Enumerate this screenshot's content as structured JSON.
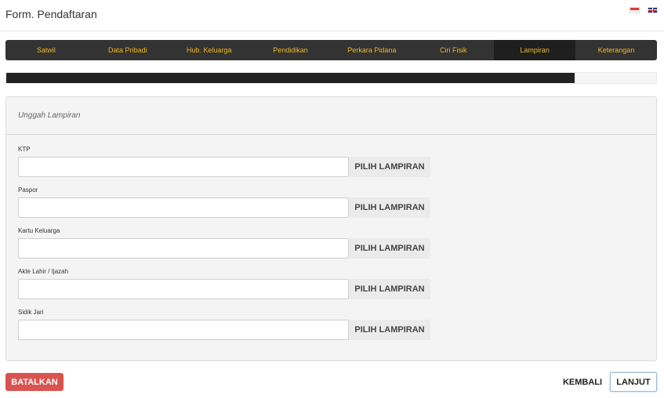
{
  "header": {
    "title": "Form. Pendaftaran",
    "flags": [
      {
        "name": "indonesia-flag-icon",
        "colors": [
          "#e53935",
          "#f5f5f5"
        ]
      },
      {
        "name": "uk-flag-icon",
        "colors": [
          "#1a3d8f",
          "#ffffff",
          "#c62828"
        ]
      }
    ]
  },
  "tabs": [
    {
      "label": "Satwil",
      "active": false
    },
    {
      "label": "Data Pribadi",
      "active": false
    },
    {
      "label": "Hub. Keluarga",
      "active": false
    },
    {
      "label": "Pendidikan",
      "active": false
    },
    {
      "label": "Perkara Pidana",
      "active": false
    },
    {
      "label": "Ciri Fisik",
      "active": false
    },
    {
      "label": "Lampiran",
      "active": true
    },
    {
      "label": "Keterangan",
      "active": false
    }
  ],
  "progress": {
    "fraction": 0.875
  },
  "panel": {
    "title": "Unggah Lampiran",
    "fields": [
      {
        "label": "KTP",
        "value": "",
        "button": "PILIH LAMPIRAN"
      },
      {
        "label": "Paspor",
        "value": "",
        "button": "PILIH LAMPIRAN"
      },
      {
        "label": "Kartu Keluarga",
        "value": "",
        "button": "PILIH LAMPIRAN"
      },
      {
        "label": "Akte Lahir / Ijazah",
        "value": "",
        "button": "PILIH LAMPIRAN"
      },
      {
        "label": "Sidik Jari",
        "value": "",
        "button": "PILIH LAMPIRAN"
      }
    ]
  },
  "footer": {
    "cancel_label": "BATALKAN",
    "back_label": "KEMBALI",
    "next_label": "LANJUT"
  },
  "colors": {
    "accent_tab_text": "#f0b429",
    "tab_bar": "#333333",
    "danger": "#d9534f"
  }
}
